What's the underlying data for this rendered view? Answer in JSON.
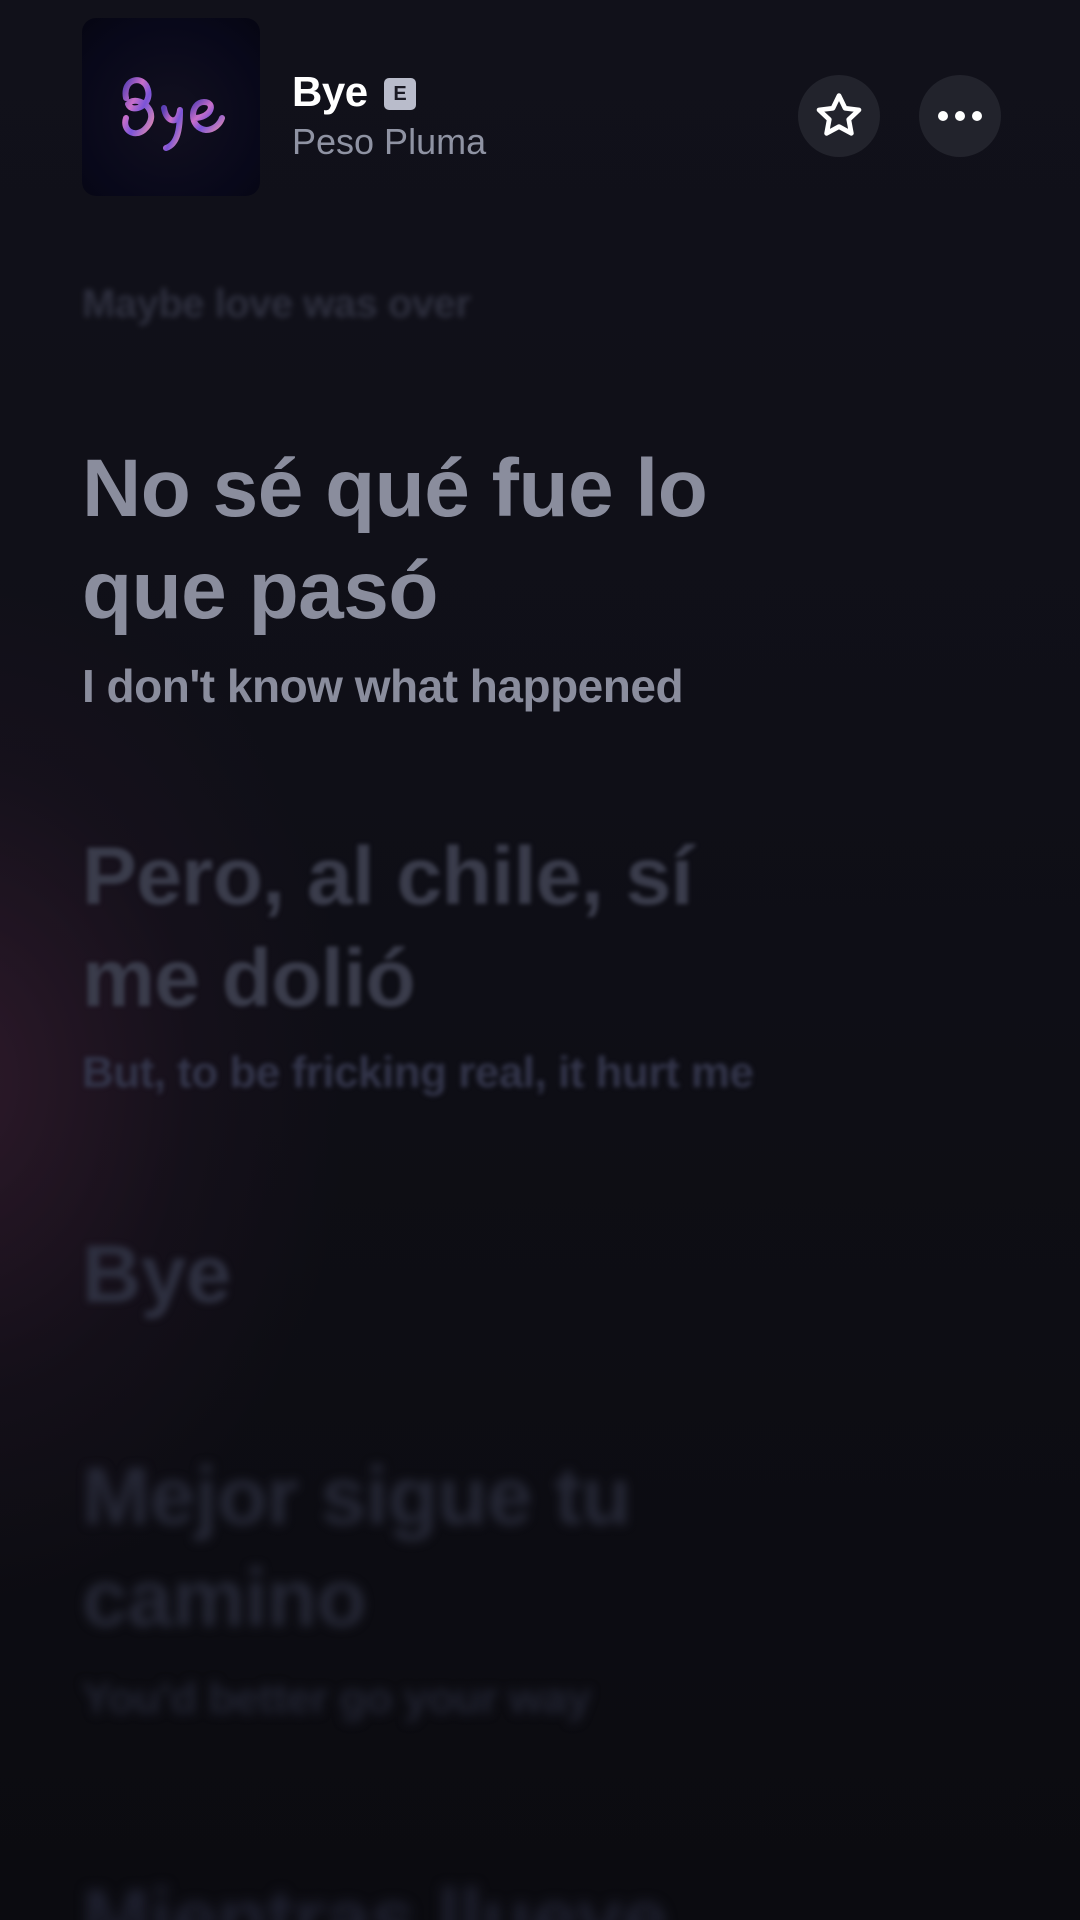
{
  "track": {
    "title": "Bye",
    "explicit_badge": "E",
    "artist": "Peso Pluma",
    "album_art_text": "Bye"
  },
  "icons": {
    "favorite": "star-outline-icon",
    "more": "more-horizontal-icon"
  },
  "lyrics": {
    "previous": "Maybe love was over",
    "current": {
      "original": "No sé qué fue lo que pasó",
      "translation": "I don't know what happened"
    },
    "next": {
      "original": "Pero, al chile, sí me dolió",
      "translation": "But, to be fricking real, it hurt me"
    },
    "bye": "Bye",
    "after": {
      "original": "Mejor sigue tu camino",
      "translation": "You'd better go your way"
    },
    "bottom": "Mientras llueve"
  },
  "colors": {
    "background": "#0c0c12",
    "active_lyric": "#8a8d9d",
    "title": "#ffffff",
    "artist": "#8f93a3",
    "button_bg": "#22232c"
  }
}
